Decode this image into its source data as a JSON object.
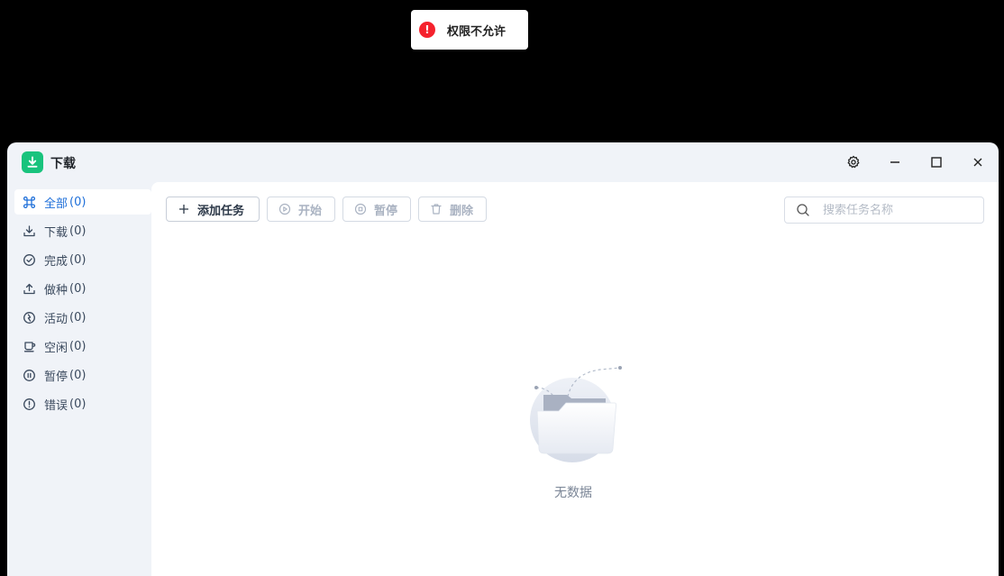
{
  "toast": {
    "message": "权限不允许",
    "icon": "error-icon",
    "color": "#f5222d"
  },
  "window": {
    "title": "下载",
    "logo_color": "#19c37d",
    "controls": [
      "settings-icon",
      "minimize-icon",
      "maximize-icon",
      "close-icon"
    ]
  },
  "sidebar": {
    "accent": "#1e6fd9",
    "items": [
      {
        "icon": "command-icon",
        "label": "全部",
        "count": "(0)",
        "active": true
      },
      {
        "icon": "download-icon",
        "label": "下载",
        "count": "(0)"
      },
      {
        "icon": "check-circle-icon",
        "label": "完成",
        "count": "(0)"
      },
      {
        "icon": "upload-icon",
        "label": "做种",
        "count": "(0)"
      },
      {
        "icon": "activity-icon",
        "label": "活动",
        "count": "(0)"
      },
      {
        "icon": "coffee-icon",
        "label": "空闲",
        "count": "(0)"
      },
      {
        "icon": "pause-circle-icon",
        "label": "暂停",
        "count": "(0)"
      },
      {
        "icon": "alert-circle-icon",
        "label": "错误",
        "count": "(0)"
      }
    ]
  },
  "toolbar": {
    "add_label": "添加任务",
    "start_label": "开始",
    "pause_label": "暂停",
    "delete_label": "删除"
  },
  "search": {
    "placeholder": "搜索任务名称",
    "value": ""
  },
  "empty": {
    "text": "无数据"
  }
}
